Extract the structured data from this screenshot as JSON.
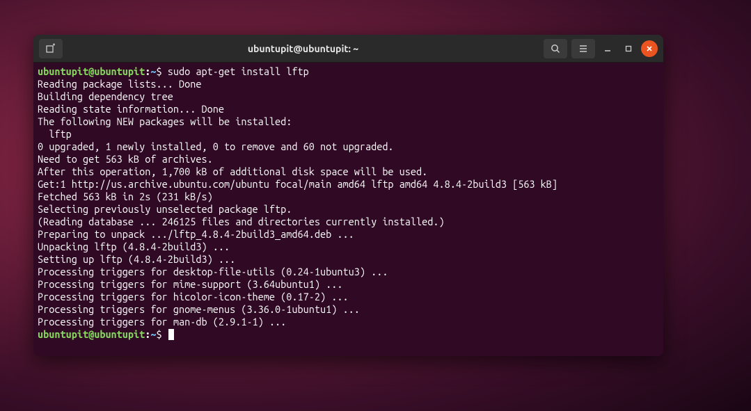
{
  "window": {
    "title": "ubuntupit@ubuntupit: ~"
  },
  "prompt": {
    "user_host": "ubuntupit@ubuntupit",
    "path": "~",
    "symbol": "$"
  },
  "commands": {
    "cmd1": "sudo apt-get install lftp"
  },
  "output": {
    "l1": "Reading package lists... Done",
    "l2": "Building dependency tree",
    "l3": "Reading state information... Done",
    "l4": "The following NEW packages will be installed:",
    "l5": "  lftp",
    "l6": "0 upgraded, 1 newly installed, 0 to remove and 60 not upgraded.",
    "l7": "Need to get 563 kB of archives.",
    "l8": "After this operation, 1,700 kB of additional disk space will be used.",
    "l9": "Get:1 http://us.archive.ubuntu.com/ubuntu focal/main amd64 lftp amd64 4.8.4-2build3 [563 kB]",
    "l10": "Fetched 563 kB in 2s (231 kB/s)",
    "l11": "Selecting previously unselected package lftp.",
    "l12": "(Reading database ... 246125 files and directories currently installed.)",
    "l13": "Preparing to unpack .../lftp_4.8.4-2build3_amd64.deb ...",
    "l14": "Unpacking lftp (4.8.4-2build3) ...",
    "l15": "Setting up lftp (4.8.4-2build3) ...",
    "l16": "Processing triggers for desktop-file-utils (0.24-1ubuntu3) ...",
    "l17": "Processing triggers for mime-support (3.64ubuntu1) ...",
    "l18": "Processing triggers for hicolor-icon-theme (0.17-2) ...",
    "l19": "Processing triggers for gnome-menus (3.36.0-1ubuntu1) ...",
    "l20": "Processing triggers for man-db (2.9.1-1) ..."
  }
}
